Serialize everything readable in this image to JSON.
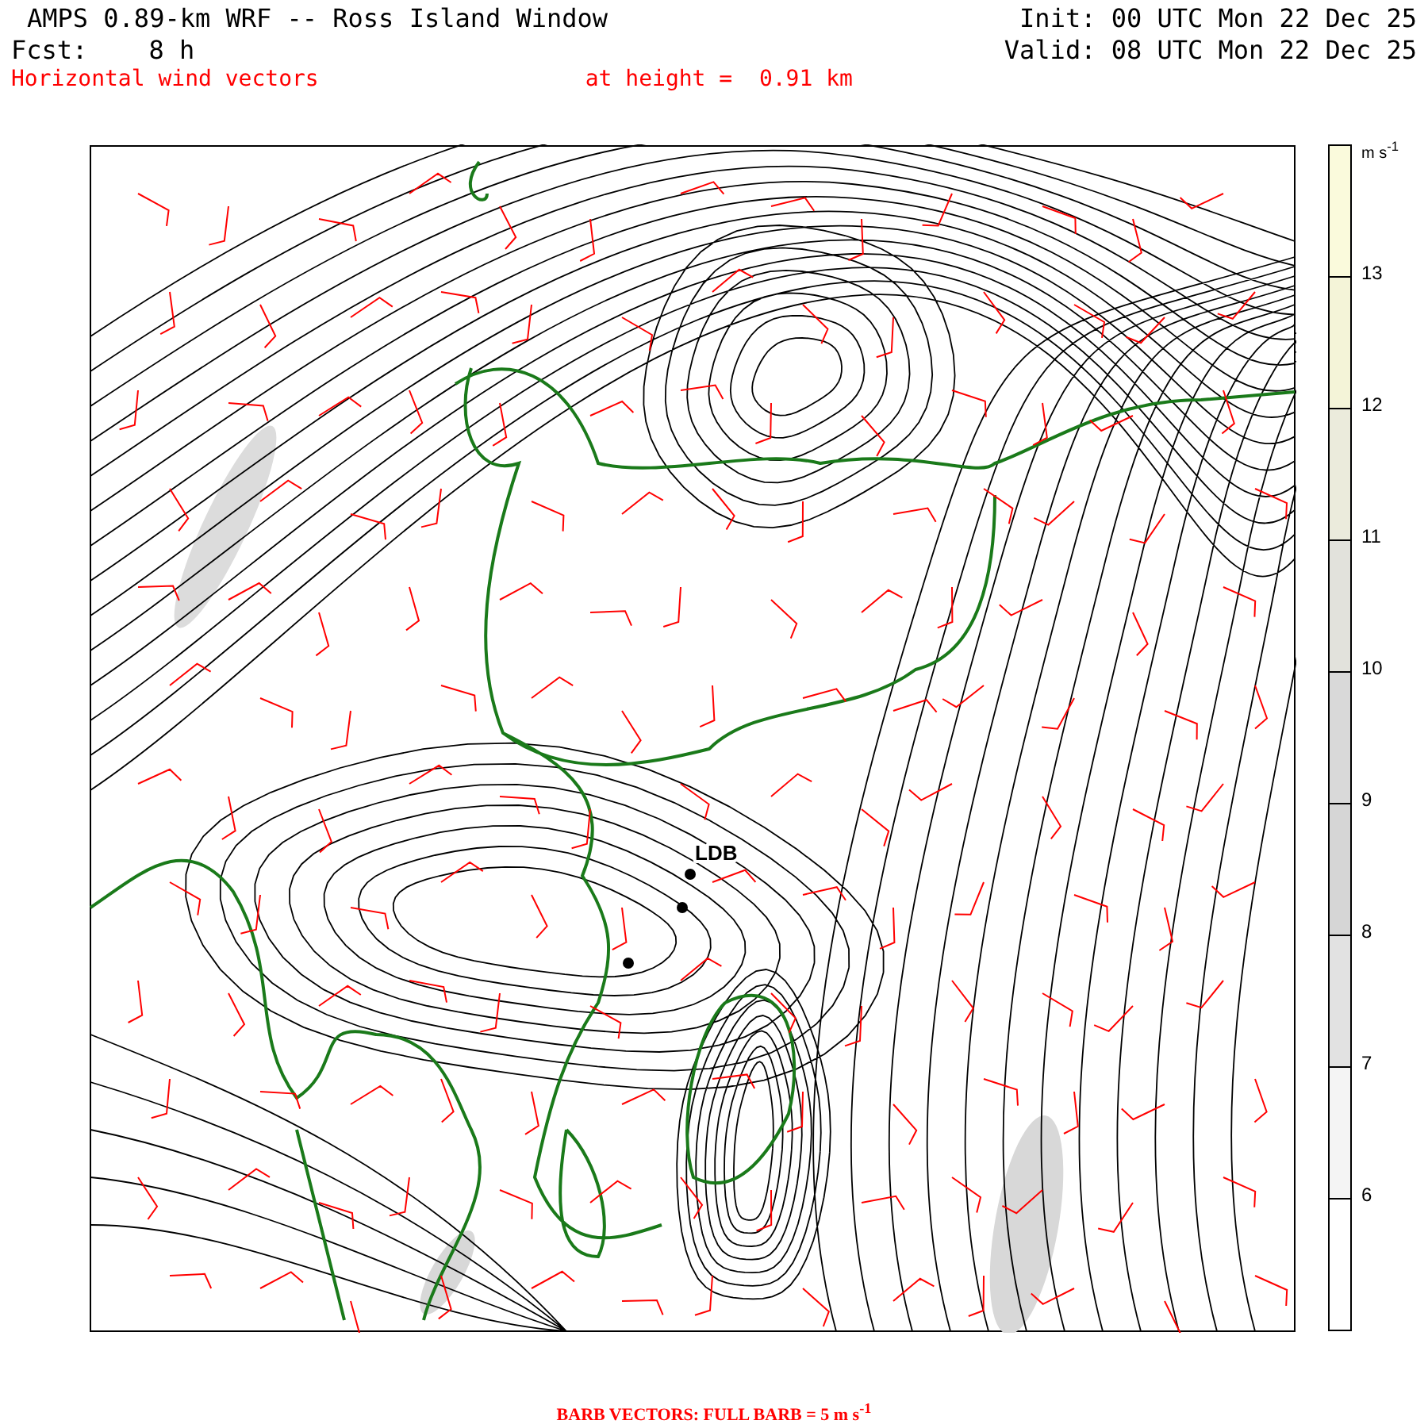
{
  "header": {
    "title": "AMPS 0.89-km WRF -- Ross Island Window",
    "init": "Init: 00 UTC Mon 22 Dec 25",
    "fcst": "Fcst:    8 h",
    "valid": "Valid: 08 UTC Mon 22 Dec 25",
    "field": "Horizontal wind vectors",
    "height": "at height =  0.91 km"
  },
  "map": {
    "station_label": "LDB"
  },
  "colorbar": {
    "unit": "m s$^{-1}$",
    "bins": [
      {
        "color": "#fafadc"
      },
      {
        "color": "#f4f4d8"
      },
      {
        "color": "#ebebdc"
      },
      {
        "color": "#e2e2dc"
      },
      {
        "color": "#d9d9d9"
      },
      {
        "color": "#d6d6d6"
      },
      {
        "color": "#e2e2e2"
      },
      {
        "color": "#f4f4f4"
      },
      {
        "color": "#ffffff"
      }
    ],
    "ticks": [
      "13",
      "12",
      "11",
      "10",
      "9",
      "8",
      "7",
      "6"
    ]
  },
  "footer": "BARB VECTORS:  FULL BARB = 5 m s$^{-1}$"
}
